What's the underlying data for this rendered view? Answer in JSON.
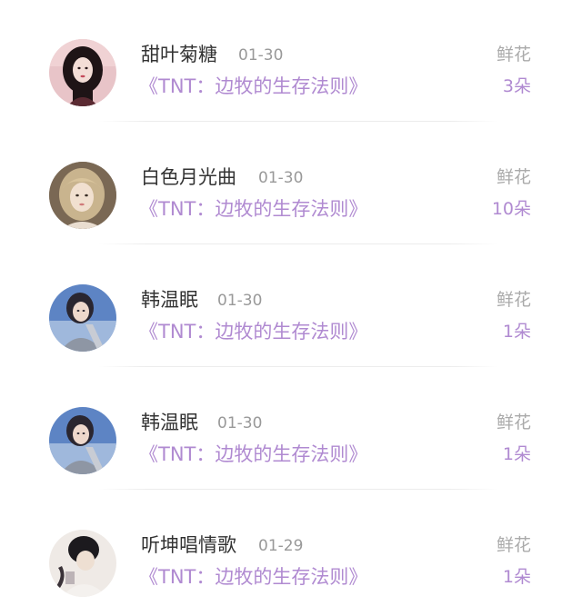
{
  "items": [
    {
      "name": "甜叶菊糖",
      "date": "01-30",
      "book": "《TNT：边牧的生存法则》",
      "gift": "鲜花",
      "count": "3朵",
      "avatar": "avatar-woman-dark-hair-pink-bg"
    },
    {
      "name": "白色月光曲",
      "date": "01-30",
      "book": "《TNT：边牧的生存法则》",
      "gift": "鲜花",
      "count": "10朵",
      "avatar": "avatar-woman-blonde-hair"
    },
    {
      "name": "韩温眠",
      "date": "01-30",
      "book": "《TNT：边牧的生存法则》",
      "gift": "鲜花",
      "count": "1朵",
      "avatar": "avatar-person-blue-bg"
    },
    {
      "name": "韩温眠",
      "date": "01-30",
      "book": "《TNT：边牧的生存法则》",
      "gift": "鲜花",
      "count": "1朵",
      "avatar": "avatar-person-blue-bg"
    },
    {
      "name": "听坤唱情歌",
      "date": "01-29",
      "book": "《TNT：边牧的生存法则》",
      "gift": "鲜花",
      "count": "1朵",
      "avatar": "avatar-person-dark-hair-bun"
    }
  ]
}
